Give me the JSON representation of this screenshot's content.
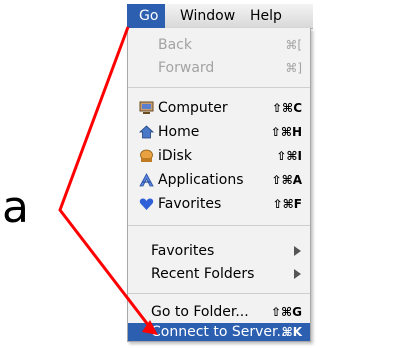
{
  "menubar": {
    "go": "Go",
    "window": "Window",
    "help": "Help"
  },
  "menu": {
    "back": {
      "label": "Back",
      "shortcut": "⌘["
    },
    "forward": {
      "label": "Forward",
      "shortcut": "⌘]"
    },
    "computer": {
      "label": "Computer",
      "shortcut": "⇧⌘C",
      "icon": "computer-icon"
    },
    "home": {
      "label": "Home",
      "shortcut": "⇧⌘H",
      "icon": "home-icon"
    },
    "idisk": {
      "label": "iDisk",
      "shortcut": "⇧⌘I",
      "icon": "idisk-icon"
    },
    "applications": {
      "label": "Applications",
      "shortcut": "⇧⌘A",
      "icon": "applications-icon"
    },
    "favorites": {
      "label": "Favorites",
      "shortcut": "⇧⌘F",
      "icon": "favorites-heart-icon"
    },
    "favorites_sub": {
      "label": "Favorites"
    },
    "recent_folders": {
      "label": "Recent Folders"
    },
    "go_to_folder": {
      "label": "Go to Folder...",
      "shortcut": "⇧⌘G"
    },
    "connect_to_server": {
      "label": "Connect to Server...",
      "shortcut": "⌘K"
    }
  },
  "annotation": {
    "letter": "a",
    "color": "#ff0000"
  },
  "colors": {
    "highlight": "#2c5fb0",
    "menu_bg": "#f2f2f2",
    "disabled_text": "#a3a3a3"
  }
}
